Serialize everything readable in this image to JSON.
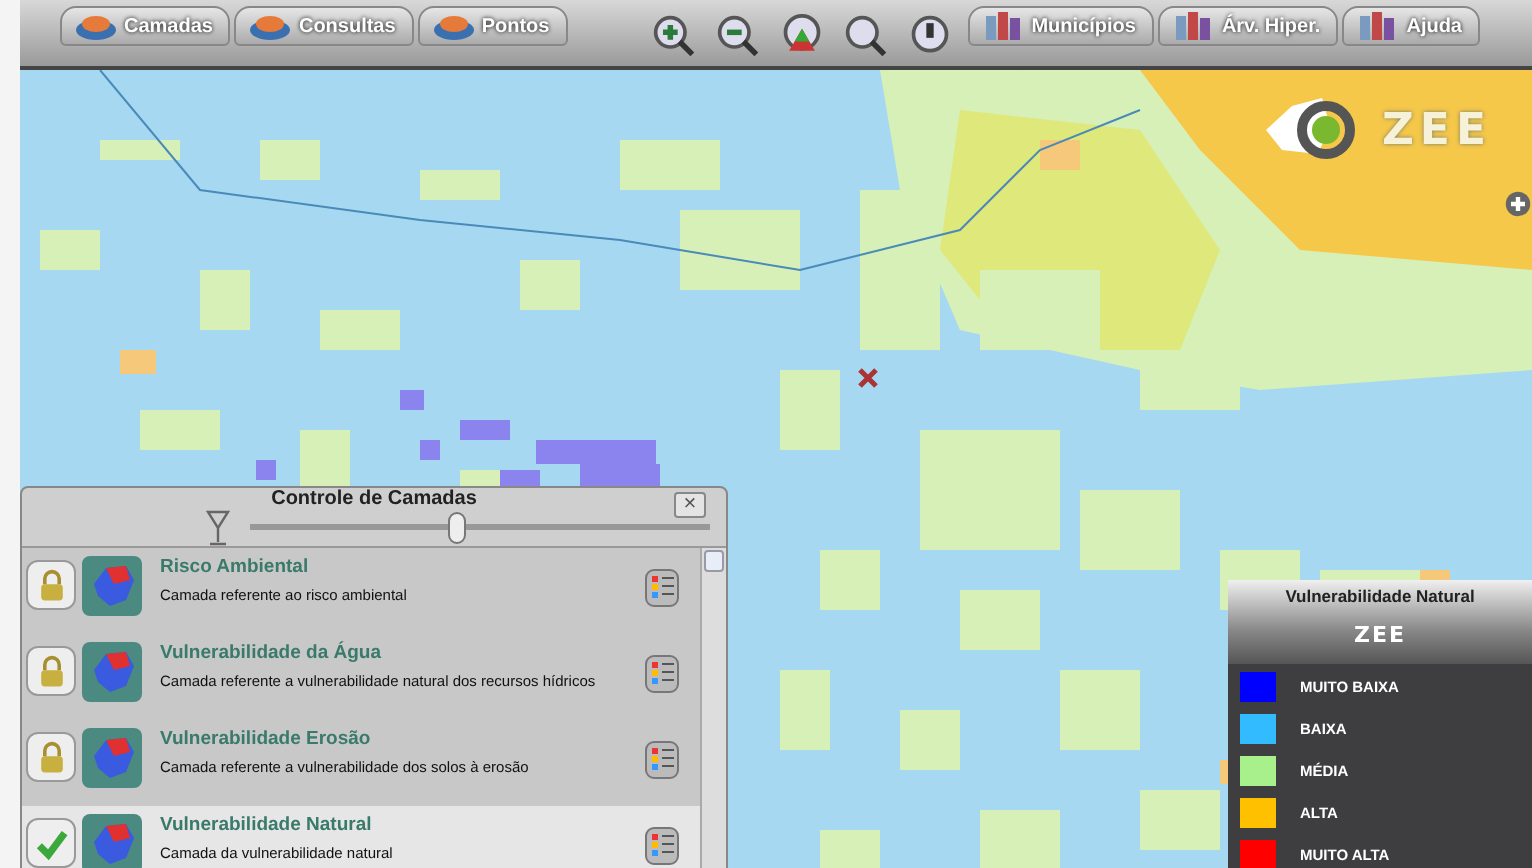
{
  "toolbar": {
    "left_menus": [
      {
        "label": "Camadas"
      },
      {
        "label": "Consultas"
      },
      {
        "label": "Pontos"
      }
    ],
    "right_menus": [
      {
        "label": "Municípios"
      },
      {
        "label": "Árv. Hiper."
      },
      {
        "label": "Ajuda"
      }
    ]
  },
  "logo": {
    "text": "ZEE"
  },
  "layer_panel": {
    "title": "Controle de Camadas",
    "close": "×",
    "opacity": {
      "level": 0.45
    },
    "layers": [
      {
        "name": "Risco Ambiental",
        "description": "Camada referente ao risco ambiental",
        "visible": false
      },
      {
        "name": "Vulnerabilidade da Água",
        "description": "Camada referente a vulnerabilidade natural dos recursos hídricos",
        "visible": false
      },
      {
        "name": "Vulnerabilidade Erosão",
        "description": "Camada referente a vulnerabilidade dos solos à erosão",
        "visible": false
      },
      {
        "name": "Vulnerabilidade Natural",
        "description": "Camada da vulnerabilidade natural",
        "visible": true
      }
    ]
  },
  "legend": {
    "title": "Vulnerabilidade Natural",
    "logo_text": "ZEE",
    "items": [
      {
        "label": "MUITO BAIXA",
        "color": "#0000ff"
      },
      {
        "label": "BAIXA",
        "color": "#33bbff"
      },
      {
        "label": "MÉDIA",
        "color": "#a8f08c"
      },
      {
        "label": "ALTA",
        "color": "#ffc000"
      },
      {
        "label": "MUITO ALTA",
        "color": "#ff0000"
      }
    ]
  }
}
